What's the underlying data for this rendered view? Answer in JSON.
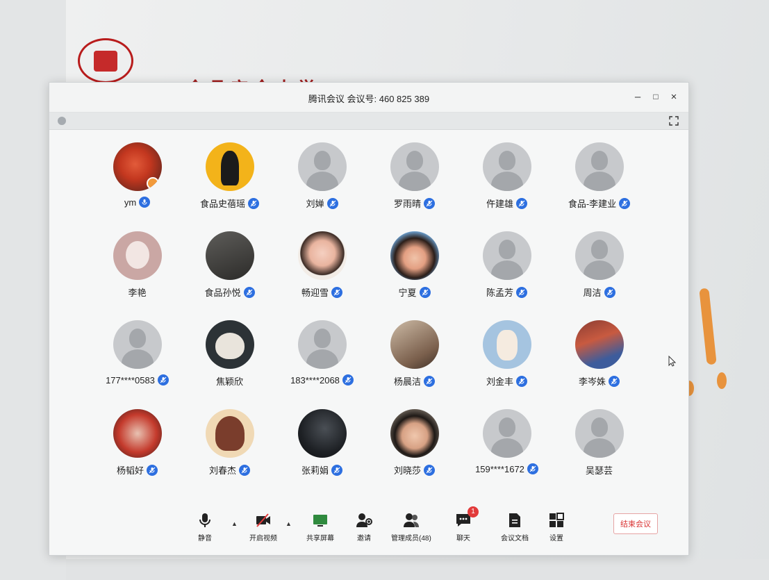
{
  "window": {
    "title": "腾讯会议 会议号: 460 825 389",
    "minimize_icon": "minus",
    "maximize_icon": "square",
    "close_icon": "x"
  },
  "background": {
    "university_title": "食品安全大学",
    "accent_color": "#a11f1f"
  },
  "participants": [
    {
      "name": "ym",
      "avatar": "flower-photo",
      "mic": "on",
      "host": true
    },
    {
      "name": "食品史蓓瑶",
      "avatar": "yellow-silhouette",
      "mic": "muted"
    },
    {
      "name": "刘婵",
      "avatar": "default",
      "mic": "muted"
    },
    {
      "name": "罗雨晴",
      "avatar": "default",
      "mic": "muted"
    },
    {
      "name": "仵建雄",
      "avatar": "default",
      "mic": "muted"
    },
    {
      "name": "食品-李建业",
      "avatar": "default",
      "mic": "muted"
    },
    {
      "name": "李艳",
      "avatar": "bunny-photo",
      "mic": "none"
    },
    {
      "name": "食品孙悦",
      "avatar": "dark-photo",
      "mic": "muted"
    },
    {
      "name": "畅迎雪",
      "avatar": "girl-photo",
      "mic": "muted"
    },
    {
      "name": "宁夏",
      "avatar": "girl-photo",
      "mic": "muted"
    },
    {
      "name": "陈孟芳",
      "avatar": "default",
      "mic": "muted"
    },
    {
      "name": "周洁",
      "avatar": "default",
      "mic": "muted"
    },
    {
      "name": "177****0583",
      "avatar": "default",
      "mic": "muted"
    },
    {
      "name": "焦颖欣",
      "avatar": "cat-photo",
      "mic": "none"
    },
    {
      "name": "183****2068",
      "avatar": "default",
      "mic": "muted"
    },
    {
      "name": "杨晨洁",
      "avatar": "room-photo",
      "mic": "muted"
    },
    {
      "name": "刘金丰",
      "avatar": "cartoon-photo",
      "mic": "muted"
    },
    {
      "name": "李岑姝",
      "avatar": "mask-photo",
      "mic": "muted"
    },
    {
      "name": "杨韬好",
      "avatar": "red-photo",
      "mic": "muted"
    },
    {
      "name": "刘春杰",
      "avatar": "anime-photo",
      "mic": "muted"
    },
    {
      "name": "张莉娟",
      "avatar": "dark-photo",
      "mic": "muted"
    },
    {
      "name": "刘晓莎",
      "avatar": "boy-photo",
      "mic": "muted"
    },
    {
      "name": "159****1672",
      "avatar": "default",
      "mic": "muted"
    },
    {
      "name": "吴瑟芸",
      "avatar": "default",
      "mic": "none"
    }
  ],
  "toolbar": {
    "mute_label": "静音",
    "video_label": "开启视频",
    "share_label": "共享屏幕",
    "invite_label": "邀请",
    "members_label": "管理成员(48)",
    "chat_label": "聊天",
    "chat_badge": "1",
    "docs_label": "会议文档",
    "settings_label": "设置",
    "end_label": "结束会议"
  },
  "colors": {
    "mic_blue": "#2d6fe0",
    "end_red": "#d93232",
    "badge_red": "#e23b3b"
  }
}
